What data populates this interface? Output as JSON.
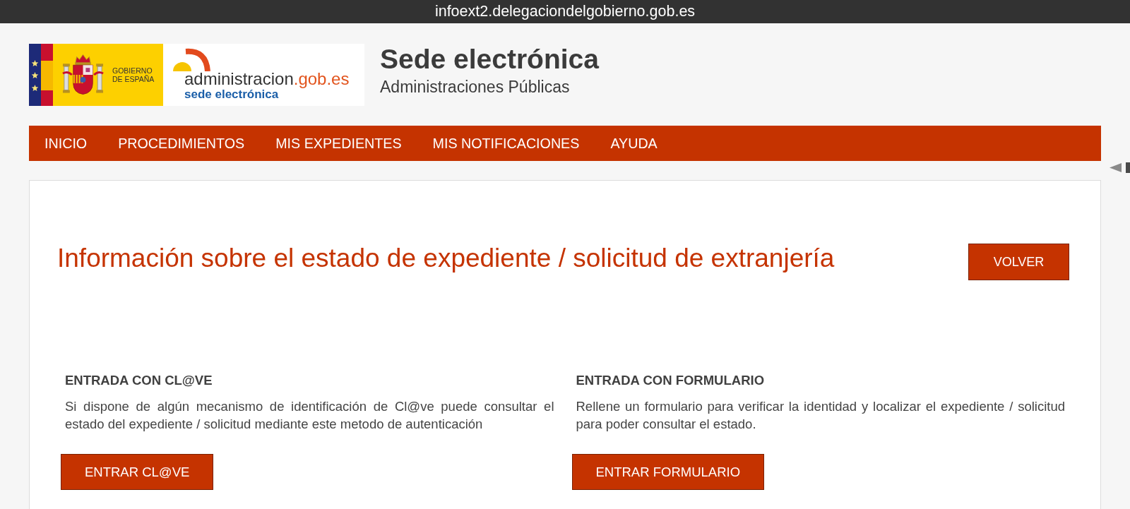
{
  "browser": {
    "url": "infoext2.delegaciondelgobierno.gob.es"
  },
  "header": {
    "government_logo": {
      "lines": [
        "GOBIERNO",
        "DE ESPAÑA"
      ]
    },
    "administration_logo": {
      "wordmark": "administracion",
      "wordmark_suffix": ".gob.es",
      "tagline": "sede electrónica"
    },
    "title": "Sede electrónica",
    "subtitle": "Administraciones Públicas"
  },
  "nav": {
    "items": [
      {
        "label": "INICIO"
      },
      {
        "label": "PROCEDIMIENTOS"
      },
      {
        "label": "MIS EXPEDIENTES"
      },
      {
        "label": "MIS NOTIFICACIONES"
      },
      {
        "label": "AYUDA"
      }
    ]
  },
  "content": {
    "title": "Información sobre el estado de expediente / solicitud de extranjería",
    "back_button": "VOLVER",
    "sections": [
      {
        "heading": "ENTRADA CON CL@VE",
        "text": "Si dispone de algún mecanismo de identificación de Cl@ve puede consultar el estado del expediente / solicitud mediante este metodo de autenticación",
        "button": "ENTRAR CL@VE"
      },
      {
        "heading": "ENTRADA CON FORMULARIO",
        "text": "Rellene un formulario para verificar la identidad y localizar el expediente / solicitud para poder consultar el estado.",
        "button": "ENTRAR FORMULARIO"
      }
    ]
  }
}
